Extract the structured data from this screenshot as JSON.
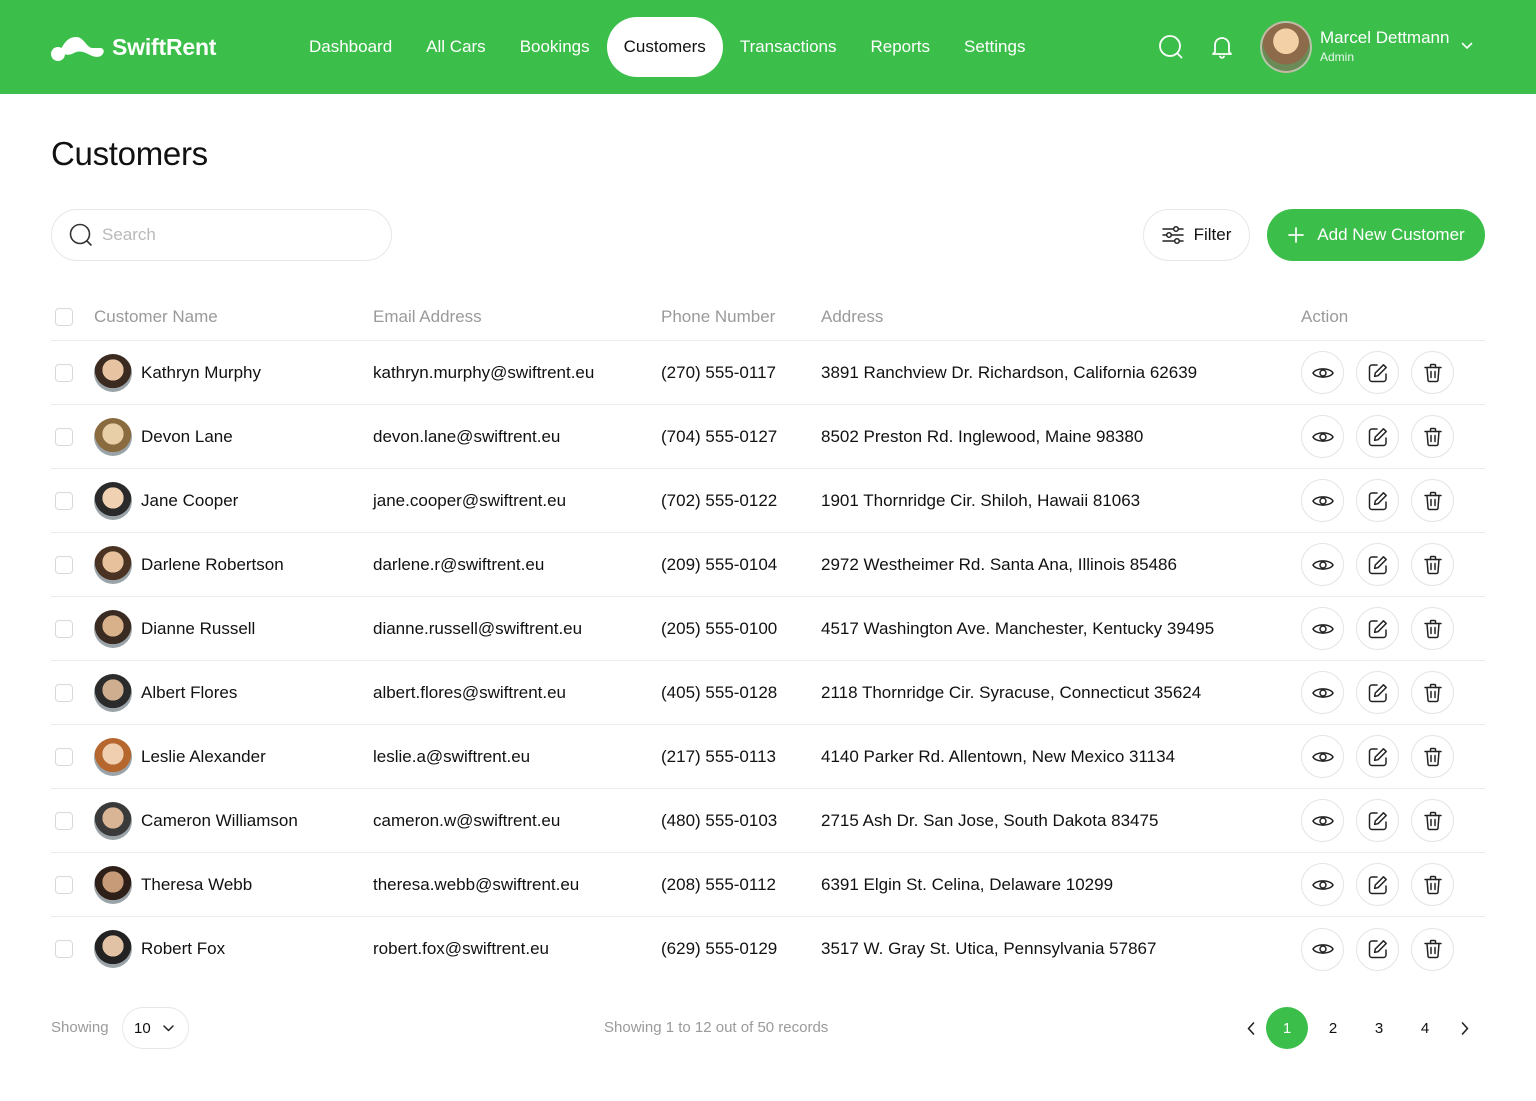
{
  "brand": {
    "name": "SwiftRent",
    "accent": "#3bbf4a"
  },
  "nav": {
    "items": [
      {
        "label": "Dashboard"
      },
      {
        "label": "All Cars"
      },
      {
        "label": "Bookings"
      },
      {
        "label": "Customers"
      },
      {
        "label": "Transactions"
      },
      {
        "label": "Reports"
      },
      {
        "label": "Settings"
      }
    ],
    "active": "Customers"
  },
  "header_icons": {
    "search": "search-icon",
    "notifications": "bell-icon"
  },
  "user": {
    "name": "Marcel Dettmann",
    "role": "Admin"
  },
  "page": {
    "title": "Customers"
  },
  "toolbar": {
    "search_placeholder": "Search",
    "search_value": "",
    "filter_label": "Filter",
    "add_label": "Add New Customer"
  },
  "table": {
    "columns": [
      "Customer Name",
      "Email Address",
      "Phone Number",
      "Address",
      "Action"
    ],
    "rows": [
      {
        "name": "Kathryn Murphy",
        "email": "kathryn.murphy@swiftrent.eu",
        "phone": "(270) 555-0117",
        "address": "3891 Ranchview Dr. Richardson, California 62639"
      },
      {
        "name": "Devon Lane",
        "email": "devon.lane@swiftrent.eu",
        "phone": "(704) 555-0127",
        "address": "8502 Preston Rd. Inglewood, Maine 98380"
      },
      {
        "name": "Jane Cooper",
        "email": "jane.cooper@swiftrent.eu",
        "phone": "(702) 555-0122",
        "address": "1901 Thornridge Cir. Shiloh, Hawaii 81063"
      },
      {
        "name": "Darlene Robertson",
        "email": "darlene.r@swiftrent.eu",
        "phone": "(209) 555-0104",
        "address": "2972 Westheimer Rd. Santa Ana, Illinois 85486"
      },
      {
        "name": "Dianne Russell",
        "email": "dianne.russell@swiftrent.eu",
        "phone": "(205) 555-0100",
        "address": "4517 Washington Ave. Manchester, Kentucky 39495"
      },
      {
        "name": "Albert Flores",
        "email": "albert.flores@swiftrent.eu",
        "phone": "(405) 555-0128",
        "address": "2118 Thornridge Cir. Syracuse, Connecticut 35624"
      },
      {
        "name": "Leslie Alexander",
        "email": "leslie.a@swiftrent.eu",
        "phone": "(217) 555-0113",
        "address": "4140 Parker Rd. Allentown, New Mexico 31134"
      },
      {
        "name": "Cameron Williamson",
        "email": "cameron.w@swiftrent.eu",
        "phone": "(480) 555-0103",
        "address": "2715 Ash Dr. San Jose, South Dakota 83475"
      },
      {
        "name": "Theresa Webb",
        "email": "theresa.webb@swiftrent.eu",
        "phone": "(208) 555-0112",
        "address": "6391 Elgin St. Celina, Delaware 10299"
      },
      {
        "name": "Robert Fox",
        "email": "robert.fox@swiftrent.eu",
        "phone": "(629) 555-0129",
        "address": "3517 W. Gray St. Utica, Pennsylvania 57867"
      }
    ],
    "row_actions": [
      "eye-icon",
      "edit-icon",
      "trash-icon"
    ]
  },
  "footer": {
    "showing_label": "Showing",
    "per_page": "10",
    "records_text": "Showing 1 to 12 out of 50 records",
    "pages": [
      "1",
      "2",
      "3",
      "4"
    ],
    "current_page": "1"
  }
}
